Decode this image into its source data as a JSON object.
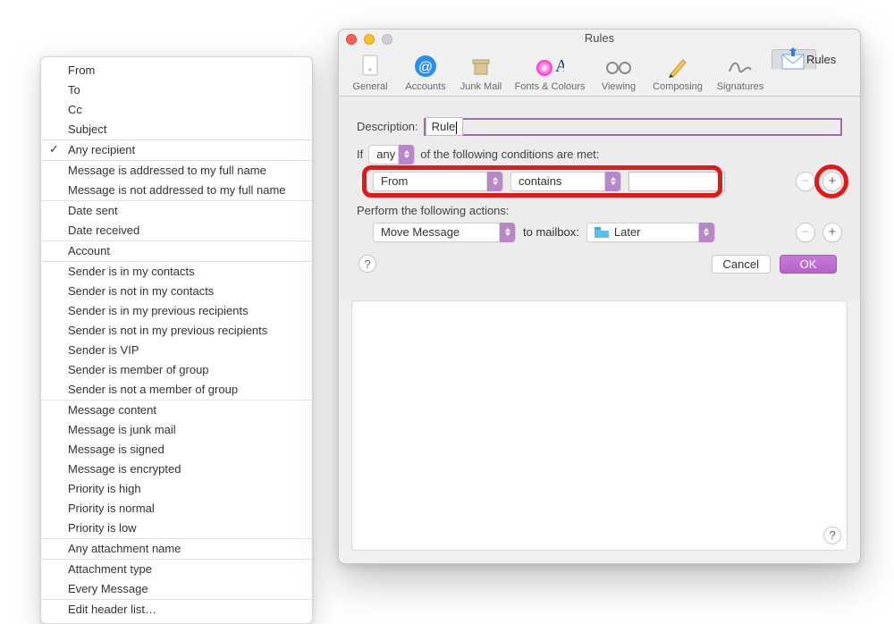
{
  "window": {
    "title": "Rules",
    "tabs": [
      {
        "id": "general",
        "label": "General"
      },
      {
        "id": "accounts",
        "label": "Accounts"
      },
      {
        "id": "junk",
        "label": "Junk Mail"
      },
      {
        "id": "fonts",
        "label": "Fonts & Colours"
      },
      {
        "id": "viewing",
        "label": "Viewing"
      },
      {
        "id": "composing",
        "label": "Composing"
      },
      {
        "id": "signatures",
        "label": "Signatures"
      },
      {
        "id": "rules",
        "label": "Rules",
        "selected": true
      }
    ]
  },
  "sheet": {
    "description_label": "Description:",
    "description_value": "Rule",
    "if_label": "If",
    "match_scope_value": "any",
    "match_scope_suffix": "of the following conditions are met:",
    "condition": {
      "field_value": "From",
      "operator_value": "contains",
      "text_value": ""
    },
    "actions_label": "Perform the following actions:",
    "action": {
      "verb_value": "Move Message",
      "to_label": "to mailbox:",
      "mailbox_value": "Later"
    },
    "help_glyph": "?",
    "cancel_label": "Cancel",
    "ok_label": "OK"
  },
  "field_menu": {
    "groups": [
      [
        "From",
        "To",
        "Cc",
        "Subject"
      ],
      [
        {
          "label": "Any recipient",
          "checked": true
        }
      ],
      [
        "Message is addressed to my full name",
        "Message is not addressed to my full name"
      ],
      [
        "Date sent",
        "Date received"
      ],
      [
        "Account"
      ],
      [
        "Sender is in my contacts",
        "Sender is not in my contacts",
        "Sender is in my previous recipients",
        "Sender is not in my previous recipients",
        "Sender is VIP",
        "Sender is member of group",
        "Sender is not a member of group"
      ],
      [
        "Message content",
        "Message is junk mail",
        "Message is signed",
        "Message is encrypted",
        "Priority is high",
        "Priority is normal",
        "Priority is low"
      ],
      [
        "Any attachment name"
      ],
      [
        "Attachment type",
        "Every Message"
      ],
      [
        "Edit header list…"
      ]
    ]
  }
}
